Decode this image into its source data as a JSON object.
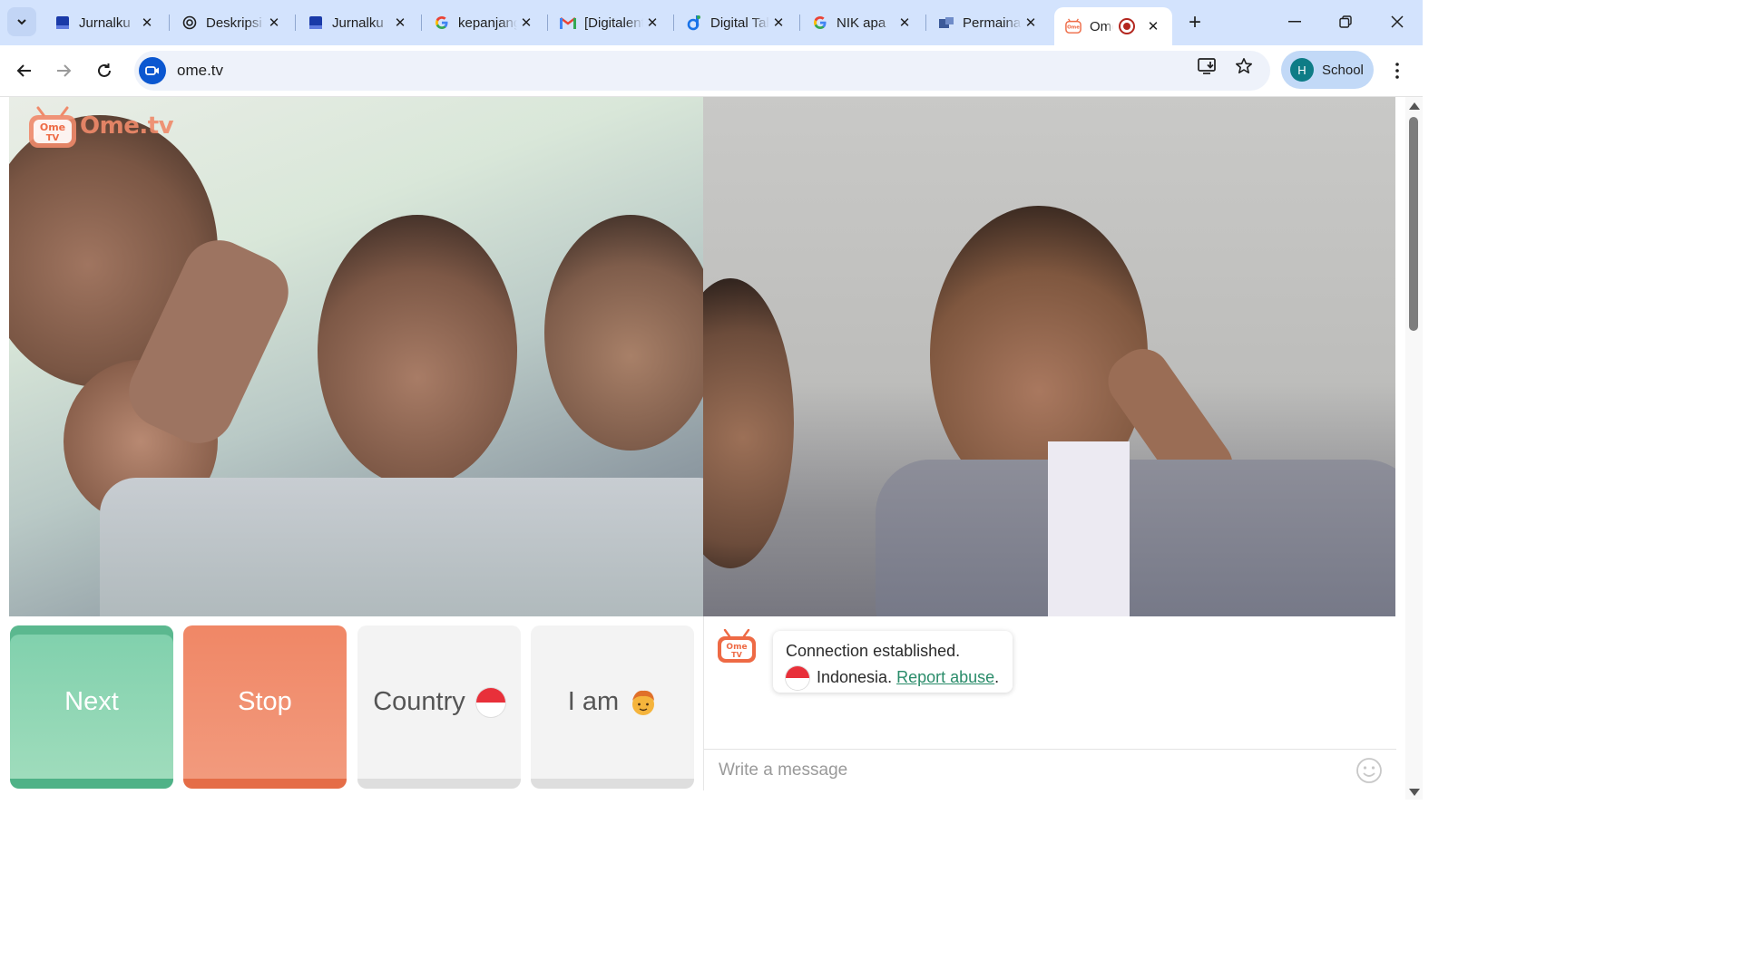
{
  "browser": {
    "tabs": [
      {
        "title": "Jurnalku",
        "icon": "doc-blue-icon"
      },
      {
        "title": "Deskripsi",
        "icon": "openai-icon"
      },
      {
        "title": "Jurnalku",
        "icon": "doc-blue-icon"
      },
      {
        "title": "kepanjangan",
        "icon": "google-icon"
      },
      {
        "title": "[Digitalent]",
        "icon": "gmail-icon"
      },
      {
        "title": "Digital Talent",
        "icon": "digitalent-icon"
      },
      {
        "title": "NIK apa",
        "icon": "google-icon"
      },
      {
        "title": "Permainan",
        "icon": "puzzle-icon"
      },
      {
        "title": "Ome",
        "icon": "ometv-icon",
        "active": true,
        "recording": true
      }
    ],
    "url": "ome.tv",
    "profile_initial": "H",
    "profile_label": "School",
    "accent": "#0b57d0"
  },
  "app": {
    "brand": "Ome.tv",
    "buttons": {
      "next": "Next",
      "stop": "Stop",
      "country": "Country",
      "iam": "I am"
    },
    "chat": {
      "line1": "Connection established.",
      "country": "Indonesia.",
      "report": "Report abuse",
      "report_suffix": ".",
      "placeholder": "Write a message"
    },
    "colors": {
      "next": "#7fd0ac",
      "stop": "#f08766",
      "link": "#2a8c6a"
    }
  }
}
